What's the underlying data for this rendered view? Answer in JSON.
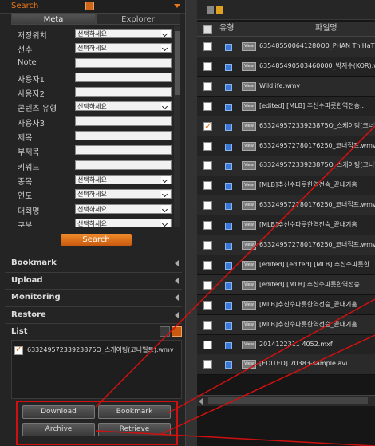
{
  "search": {
    "title": "Search"
  },
  "tabs": [
    {
      "label": "Meta"
    },
    {
      "label": "Explorer"
    }
  ],
  "form": [
    {
      "label": "저장위치",
      "value": "선택하세요",
      "type": "select"
    },
    {
      "label": "선수",
      "value": "선택하세요",
      "type": "select"
    },
    {
      "label": "Note",
      "value": "",
      "type": "text"
    },
    {
      "label": "사용자1",
      "value": "",
      "type": "text"
    },
    {
      "label": "사용자2",
      "value": "",
      "type": "text"
    },
    {
      "label": "콘텐츠 유형",
      "value": "선택하세요",
      "type": "select"
    },
    {
      "label": "사용자3",
      "value": "",
      "type": "text"
    },
    {
      "label": "제목",
      "value": "",
      "type": "text"
    },
    {
      "label": "부제목",
      "value": "",
      "type": "text"
    },
    {
      "label": "키워드",
      "value": "",
      "type": "text"
    },
    {
      "label": "종목",
      "value": "선택하세요",
      "type": "select"
    },
    {
      "label": "연도",
      "value": "선택하세요",
      "type": "select"
    },
    {
      "label": "대회명",
      "value": "선택하세요",
      "type": "select"
    },
    {
      "label": "구분",
      "value": "선택하세요",
      "type": "select"
    }
  ],
  "search_button": "Search",
  "sections": [
    "Bookmark",
    "Upload",
    "Monitoring",
    "Restore"
  ],
  "list": {
    "title": "List",
    "items": [
      {
        "name": "63324957233923875O_스케이팅(코너빌트).wmv",
        "checked": true
      }
    ]
  },
  "actions": {
    "download": "Download",
    "bookmark": "Bookmark",
    "archive": "Archive",
    "retrieve": "Retrieve"
  },
  "files": {
    "headers": {
      "type": "유형",
      "filename": "파일명"
    },
    "view_badge": "View",
    "rows": [
      {
        "name": "635485500641280O0_PHAN ThiHaTha...",
        "checked": false
      },
      {
        "name": "635485490503460000_박지수(KOR).wmv",
        "checked": false
      },
      {
        "name": "Wildlife.wmv",
        "checked": false
      },
      {
        "name": "[edited] [MLB] 추신수파릇한역전승...",
        "checked": false
      },
      {
        "name": "63324957233923875O_스케이팅(코너빌",
        "checked": true
      },
      {
        "name": "633249572780176250_코너접프.wmv",
        "checked": false
      },
      {
        "name": "63324957233923875O_스케이팅(코너빌",
        "checked": false
      },
      {
        "name": "[MLB]추신수파릇한역전승_끝내기홈",
        "checked": false
      },
      {
        "name": "633249572780176250_코너접프.wmv",
        "checked": false
      },
      {
        "name": "[MLB]추신수파릇한역전승_끝내기홈",
        "checked": false
      },
      {
        "name": "633249572780176250_코너접프.wmv",
        "checked": false
      },
      {
        "name": "[edited] [edited] [MLB] 추신수파릇한",
        "checked": false
      },
      {
        "name": "[edited] [MLB] 추신수파릇한역전승...",
        "checked": false
      },
      {
        "name": "[MLB]추신수파릇한역전승_끝내기홈",
        "checked": false
      },
      {
        "name": "[MLB]추신수파릇한역전승_끝내기홈",
        "checked": false
      },
      {
        "name": "2014122311 4052.mxf",
        "checked": false
      },
      {
        "name": "[EDITED] 70383-sample.avi",
        "checked": false
      }
    ]
  },
  "colors": {
    "accent": "#e8761a",
    "annotation": "#d01010"
  }
}
